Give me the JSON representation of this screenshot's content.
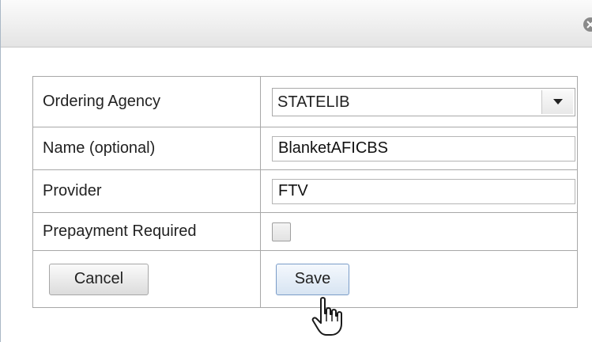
{
  "dialog": {
    "close_icon": "close-icon"
  },
  "form": {
    "rows": [
      {
        "label": "Ordering Agency",
        "value": "STATELIB"
      },
      {
        "label": "Name (optional)",
        "value": "BlanketAFICBS"
      },
      {
        "label": "Provider",
        "value": "FTV"
      },
      {
        "label": "Prepayment Required",
        "checked": false
      }
    ],
    "cancel_label": "Cancel",
    "save_label": "Save"
  },
  "colors": {
    "title_bar": "#e4e4e4",
    "border": "#a8a8a8",
    "save_button_border": "#7a9cc8"
  }
}
